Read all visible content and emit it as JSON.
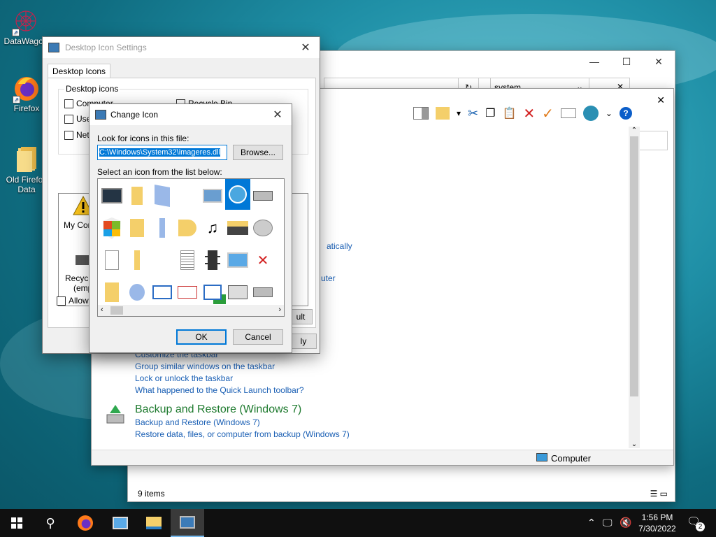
{
  "desktop": {
    "icons": [
      {
        "label": "DataWagon"
      },
      {
        "label": "Firefox"
      },
      {
        "label": "Old Firefox Data"
      }
    ]
  },
  "explorer": {
    "search_value": "system",
    "links": {
      "automatically": "atically",
      "computer": "uter",
      "customize_taskbar": "Customize the taskbar",
      "group_windows": "Group similar windows on the taskbar",
      "lock_taskbar": "Lock or unlock the taskbar",
      "quick_launch": "What happened to the Quick Launch toolbar?"
    },
    "backup": {
      "heading": "Backup and Restore (Windows 7)",
      "link1": "Backup and Restore (Windows 7)",
      "link2": "Restore data, files, or computer from backup (Windows 7)"
    },
    "status_right": "Computer",
    "item_count": "9 items"
  },
  "desktop_icon_settings": {
    "title": "Desktop Icon Settings",
    "tab": "Desktop Icons",
    "group_label": "Desktop icons",
    "checkboxes": [
      "Computer",
      "User",
      "Netw",
      "Recycle Bin"
    ],
    "preview_labels": [
      "My Comp",
      "Recycle",
      "(empt"
    ],
    "restore_default_fragment": "ult",
    "allow_fragment": "Allow t",
    "apply_fragment": "ly"
  },
  "change_icon": {
    "title": "Change Icon",
    "look_label": "Look for icons in this file:",
    "file_path": "C:\\Windows\\System32\\imageres.dll",
    "browse": "Browse...",
    "select_label": "Select an icon from the list below:",
    "ok": "OK",
    "cancel": "Cancel"
  },
  "taskbar": {
    "time": "1:56 PM",
    "date": "7/30/2022",
    "notification_count": "2"
  },
  "colors": {
    "accent": "#0078d7",
    "link": "#1a5fb4",
    "backup_heading": "#1e7a2e"
  }
}
